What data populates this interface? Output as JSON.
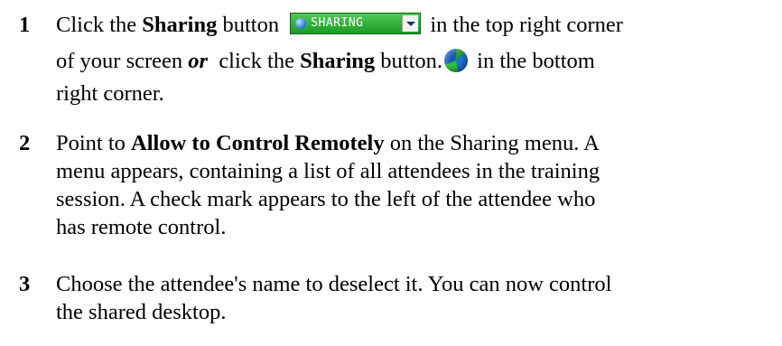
{
  "steps": [
    {
      "number": "1",
      "line1": {
        "pre": "Click the ",
        "bold": "Sharing",
        "mid": " button ",
        "post": " in the top right corner"
      },
      "sharing_button_label": "SHARING",
      "line2": {
        "pre": "of your screen ",
        "em": "or",
        "mid": "  click the ",
        "bold": "Sharing",
        "mid2": " button.",
        "post": " in the bottom"
      },
      "line3": "right corner."
    },
    {
      "number": "2",
      "line1": {
        "pre": "Point to ",
        "bold": "Allow to Control Remotely",
        "post": " on the Sharing menu. A"
      },
      "line2": "menu appears, containing a list of all attendees in the training",
      "line3": "session. A check mark appears to the left of the attendee who",
      "line4": "has remote control."
    },
    {
      "number": "3",
      "line1": "Choose the attendee's name to deselect it. You can now control",
      "line2": "the shared desktop."
    }
  ],
  "icons": {
    "sharing_button_icon": "globe-icon",
    "sharing_button_dropdown": "chevron-down-icon",
    "bottom_sharing_icon": "globe-icon"
  },
  "colors": {
    "sharing_button_green": "#1c9a26",
    "text": "#000000"
  }
}
